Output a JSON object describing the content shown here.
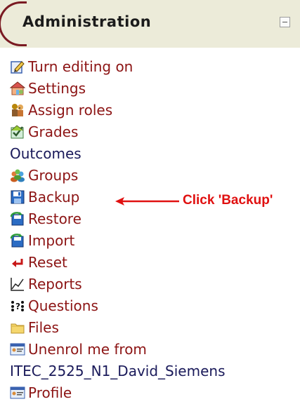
{
  "block": {
    "title": "Administration"
  },
  "menu": [
    {
      "label": "Turn editing on",
      "icon": "edit-icon",
      "link": true
    },
    {
      "label": "Settings",
      "icon": "settings-icon",
      "link": true
    },
    {
      "label": "Assign roles",
      "icon": "roles-icon",
      "link": true
    },
    {
      "label": "Grades",
      "icon": "grades-icon",
      "link": true
    },
    {
      "label": "Outcomes",
      "icon": "",
      "link": false
    },
    {
      "label": "Groups",
      "icon": "groups-icon",
      "link": true
    },
    {
      "label": "Backup",
      "icon": "backup-icon",
      "link": true
    },
    {
      "label": "Restore",
      "icon": "restore-icon",
      "link": true
    },
    {
      "label": "Import",
      "icon": "import-icon",
      "link": true
    },
    {
      "label": "Reset",
      "icon": "reset-icon",
      "link": true
    },
    {
      "label": "Reports",
      "icon": "reports-icon",
      "link": true
    },
    {
      "label": "Questions",
      "icon": "questions-icon",
      "link": true
    },
    {
      "label": "Files",
      "icon": "folder-icon",
      "link": true
    },
    {
      "label": "Unenrol me from",
      "icon": "unenrol-icon",
      "link": true
    },
    {
      "label": "ITEC_2525_N1_David_Siemens",
      "icon": "",
      "link": false
    },
    {
      "label": "Profile",
      "icon": "profile-icon",
      "link": true
    }
  ],
  "callout": {
    "text": "Click 'Backup'",
    "color": "#e01010"
  },
  "colors": {
    "header_bg": "#ecebd9",
    "link": "#8c1414",
    "accent": "#7a1a22"
  }
}
